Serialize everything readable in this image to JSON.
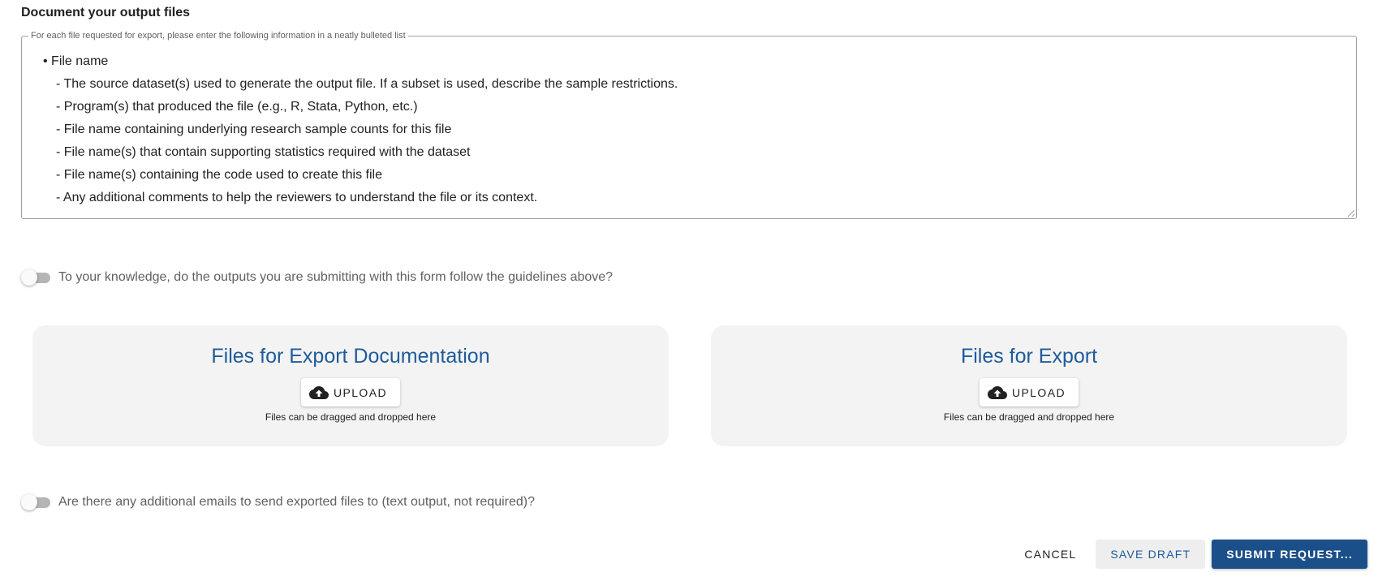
{
  "section": {
    "title": "Document your output files"
  },
  "documentation": {
    "legend": "For each file requested for export, please enter the following information in a neatly bulleted list",
    "lines": [
      "• File name",
      "- The source dataset(s) used to generate the output file. If a subset is used, describe the sample restrictions.",
      "- Program(s) that produced the file (e.g., R, Stata, Python, etc.)",
      "- File name containing underlying research sample counts for this file",
      "- File name(s) that contain supporting statistics required with the dataset",
      "- File name(s) containing the code used to create this file",
      "- Any additional comments to help the reviewers to understand the file or its context."
    ]
  },
  "guidelines_toggle": {
    "label": "To your knowledge, do the outputs you are submitting with this form follow the guidelines above?",
    "checked": false
  },
  "upload_cards": [
    {
      "title": "Files for Export Documentation",
      "button_label": "UPLOAD",
      "hint": "Files can be dragged and dropped here",
      "icon": "cloud-upload-icon"
    },
    {
      "title": "Files for Export",
      "button_label": "UPLOAD",
      "hint": "Files can be dragged and dropped here",
      "icon": "cloud-upload-icon"
    }
  ],
  "emails_toggle": {
    "label": "Are there any additional emails to send exported files to (text output, not required)?",
    "checked": false
  },
  "actions": {
    "cancel": "CANCEL",
    "save_draft": "SAVE DRAFT",
    "submit": "SUBMIT REQUEST..."
  },
  "colors": {
    "accent": "#1f5b99",
    "submit_bg": "#1b4f8a",
    "card_bg": "#f3f3f3"
  }
}
